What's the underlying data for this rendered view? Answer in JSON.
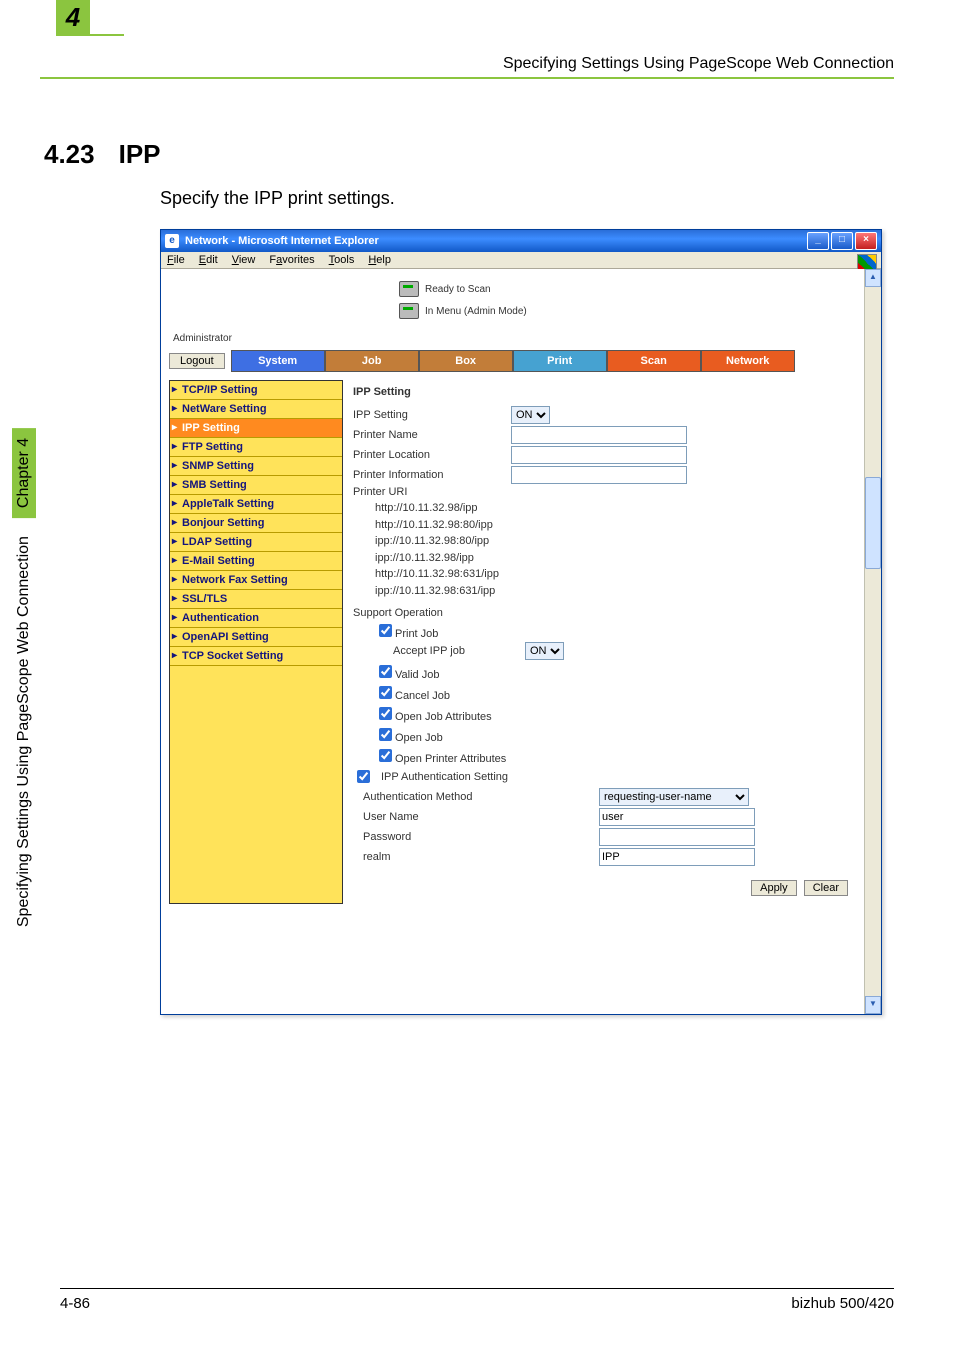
{
  "doc": {
    "chapter_num": "4",
    "header": "Specifying Settings Using PageScope Web Connection",
    "section_num": "4.23",
    "section_title": "IPP",
    "body": "Specify the IPP print settings.",
    "side_chapter": "Chapter 4",
    "side_text": "Specifying Settings Using PageScope Web Connection",
    "footer_left": "4-86",
    "footer_right": "bizhub 500/420"
  },
  "window": {
    "title": "Network - Microsoft Internet Explorer",
    "menus": [
      "File",
      "Edit",
      "View",
      "Favorites",
      "Tools",
      "Help"
    ]
  },
  "status": {
    "line1": "Ready to Scan",
    "line2": "In Menu (Admin Mode)",
    "admin_label": "Administrator",
    "logout": "Logout"
  },
  "tabs": [
    "System",
    "Job",
    "Box",
    "Print",
    "Scan",
    "Network"
  ],
  "sidebar": [
    {
      "label": "TCP/IP Setting",
      "key": "tcpip"
    },
    {
      "label": "NetWare Setting",
      "key": "netware"
    },
    {
      "label": "IPP Setting",
      "key": "ipp",
      "active": true
    },
    {
      "label": "FTP Setting",
      "key": "ftp"
    },
    {
      "label": "SNMP Setting",
      "key": "snmp"
    },
    {
      "label": "SMB Setting",
      "key": "smb"
    },
    {
      "label": "AppleTalk Setting",
      "key": "appletalk"
    },
    {
      "label": "Bonjour Setting",
      "key": "bonjour"
    },
    {
      "label": "LDAP Setting",
      "key": "ldap"
    },
    {
      "label": "E-Mail Setting",
      "key": "email"
    },
    {
      "label": "Network Fax Setting",
      "key": "netfax"
    },
    {
      "label": "SSL/TLS",
      "key": "ssl"
    },
    {
      "label": "Authentication",
      "key": "auth"
    },
    {
      "label": "OpenAPI Setting",
      "key": "openapi"
    },
    {
      "label": "TCP Socket Setting",
      "key": "tcpsock"
    }
  ],
  "panel": {
    "heading": "IPP Setting",
    "rows": {
      "ipp_setting_label": "IPP Setting",
      "ipp_setting_value": "ON",
      "printer_name_label": "Printer Name",
      "printer_name_value": "",
      "printer_location_label": "Printer Location",
      "printer_location_value": "",
      "printer_info_label": "Printer Information",
      "printer_info_value": "",
      "printer_uri_label": "Printer URI",
      "uris": [
        "http://10.11.32.98/ipp",
        "http://10.11.32.98:80/ipp",
        "ipp://10.11.32.98:80/ipp",
        "ipp://10.11.32.98/ipp",
        "http://10.11.32.98:631/ipp",
        "ipp://10.11.32.98:631/ipp"
      ],
      "support_op_label": "Support Operation",
      "print_job": "Print Job",
      "accept_ipp_label": "Accept IPP job",
      "accept_ipp_value": "ON",
      "valid_job": "Valid Job",
      "cancel_job": "Cancel Job",
      "open_job_attr": "Open Job Attributes",
      "open_job": "Open Job",
      "open_printer_attr": "Open Printer Attributes",
      "ipp_auth_label": "IPP Authentication Setting",
      "auth_method_label": "Authentication Method",
      "auth_method_value": "requesting-user-name",
      "user_name_label": "User Name",
      "user_name_value": "user",
      "password_label": "Password",
      "password_value": "",
      "realm_label": "realm",
      "realm_value": "IPP"
    },
    "buttons": {
      "apply": "Apply",
      "clear": "Clear"
    }
  }
}
